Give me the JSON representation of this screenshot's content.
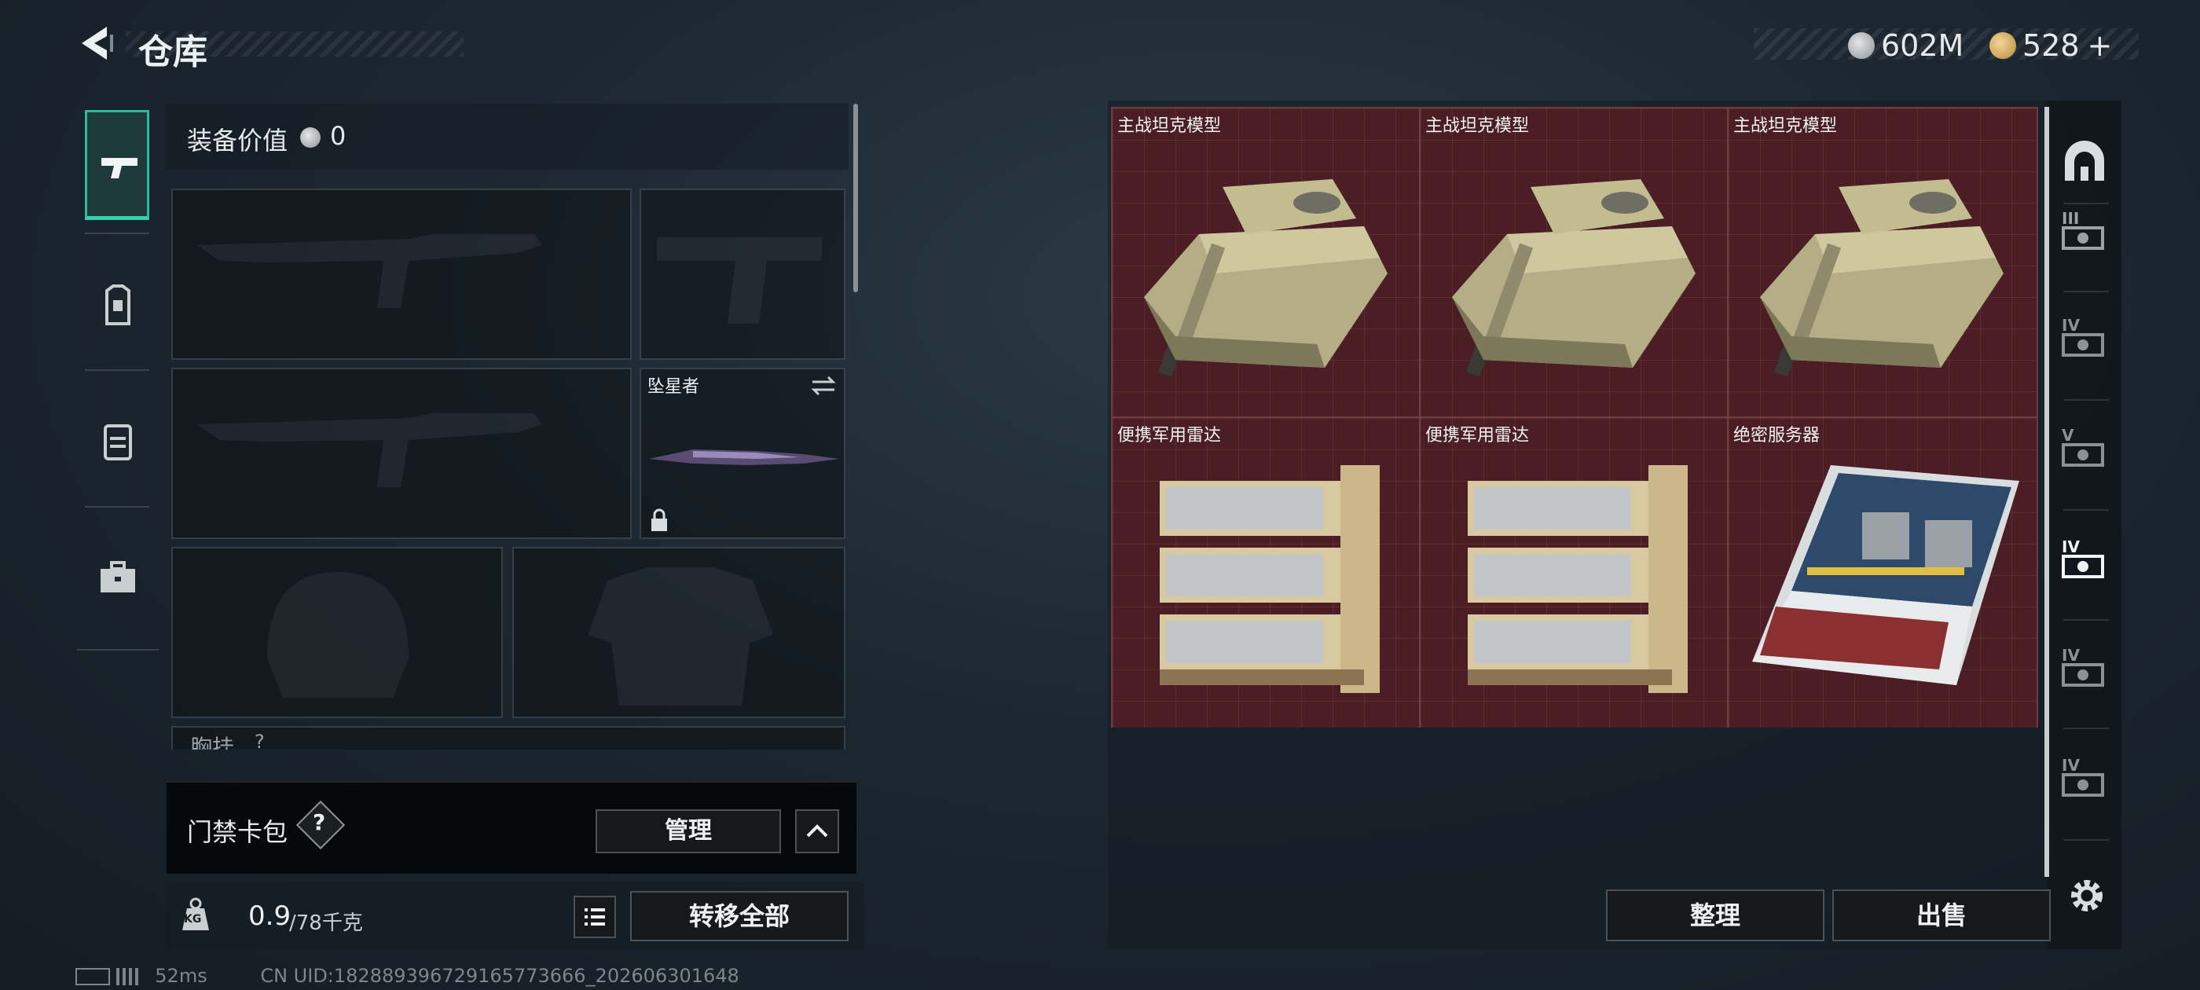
{
  "header": {
    "title": "仓库",
    "currencies": [
      {
        "icon": "silver-coin-icon",
        "value": "602M"
      },
      {
        "icon": "gold-triangle-coin-icon",
        "value": "528"
      }
    ],
    "add_symbol": "+"
  },
  "left_tabs": [
    {
      "name": "pistol-icon",
      "active": true
    },
    {
      "name": "armor-icon",
      "active": false
    },
    {
      "name": "backpack-icon",
      "active": false
    },
    {
      "name": "case-icon",
      "active": false
    }
  ],
  "equipment": {
    "value_label": "装备价值",
    "value": "0",
    "melee_name": "坠星者",
    "chest_rig_label": "胸挂",
    "chest_rig_hint": "?"
  },
  "access_card": {
    "label": "门禁卡包",
    "help": "?",
    "manage_label": "管理"
  },
  "weight": {
    "icon_text": "KG",
    "current": "0.9",
    "capacity": "/78千克",
    "transfer_all_label": "转移全部"
  },
  "warehouse": {
    "items": [
      {
        "label": "主战坦克模型",
        "type": "tank"
      },
      {
        "label": "主战坦克模型",
        "type": "tank"
      },
      {
        "label": "主战坦克模型",
        "type": "tank"
      },
      {
        "label": "便携军用雷达",
        "type": "radar"
      },
      {
        "label": "便携军用雷达",
        "type": "radar"
      },
      {
        "label": "绝密服务器",
        "type": "server"
      }
    ],
    "sort_label": "整理",
    "sell_label": "出售"
  },
  "filters": [
    "III",
    "IV",
    "V",
    "IV",
    "IV",
    "IV"
  ],
  "status": {
    "ping": "52ms",
    "uid": "CN UID:182889396729165773666_202606301648"
  },
  "colors": {
    "accent": "#34d1ad",
    "grid_bg": "#4a1e24"
  }
}
